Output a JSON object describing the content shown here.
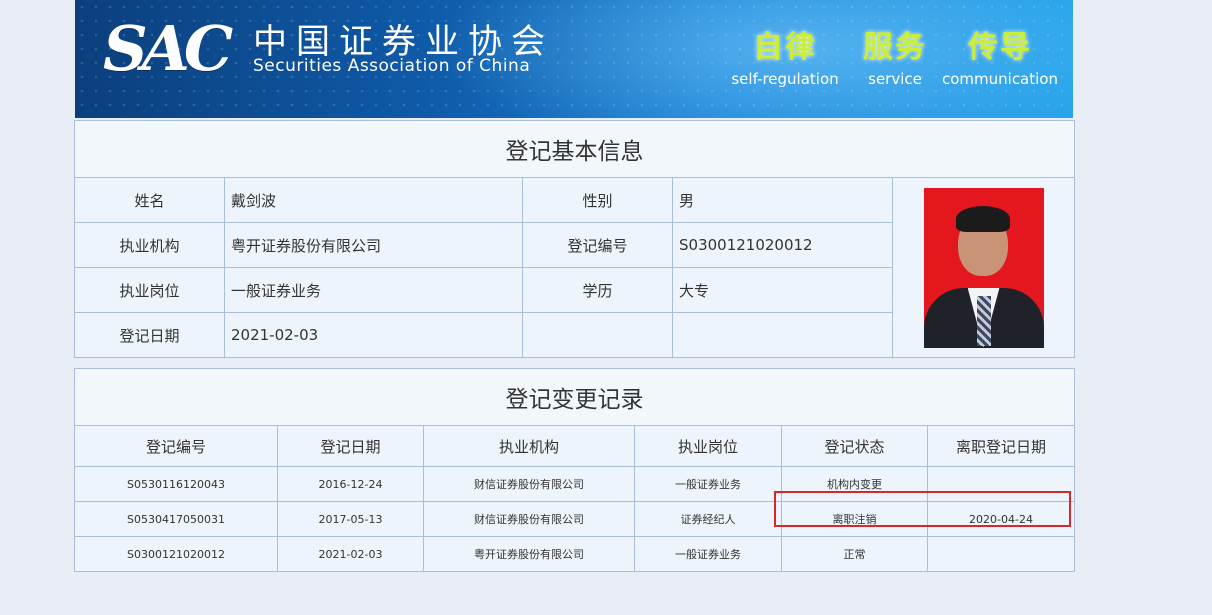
{
  "banner": {
    "logo_mark": "SAC",
    "org_name_zh": "中国证券业协会",
    "org_name_en": "Securities Association of China",
    "slogans": [
      {
        "zh": "自律",
        "en": "self-regulation"
      },
      {
        "zh": "服务",
        "en": "service"
      },
      {
        "zh": "传导",
        "en": "communication"
      }
    ]
  },
  "info": {
    "title": "登记基本信息",
    "rows": [
      {
        "l1": "姓名",
        "v1": "戴剑波",
        "l2": "性别",
        "v2": "男"
      },
      {
        "l1": "执业机构",
        "v1": "粤开证券股份有限公司",
        "l2": "登记编号",
        "v2": "S0300121020012"
      },
      {
        "l1": "执业岗位",
        "v1": "一般证券业务",
        "l2": "学历",
        "v2": "大专"
      },
      {
        "l1": "登记日期",
        "v1": "2021-02-03",
        "l2": "",
        "v2": ""
      }
    ]
  },
  "changes": {
    "title": "登记变更记录",
    "columns": [
      "登记编号",
      "登记日期",
      "执业机构",
      "执业岗位",
      "登记状态",
      "离职登记日期"
    ],
    "rows": [
      [
        "S0530116120043",
        "2016-12-24",
        "财信证券股份有限公司",
        "一般证券业务",
        "机构内变更",
        ""
      ],
      [
        "S0530417050031",
        "2017-05-13",
        "财信证券股份有限公司",
        "证券经纪人",
        "离职注销",
        "2020-04-24"
      ],
      [
        "S0300121020012",
        "2021-02-03",
        "粤开证券股份有限公司",
        "一般证券业务",
        "正常",
        ""
      ]
    ]
  },
  "colors": {
    "banner": "#0f5aa8",
    "highlight": "#d8272a",
    "slogan": "#c9ef3a"
  }
}
